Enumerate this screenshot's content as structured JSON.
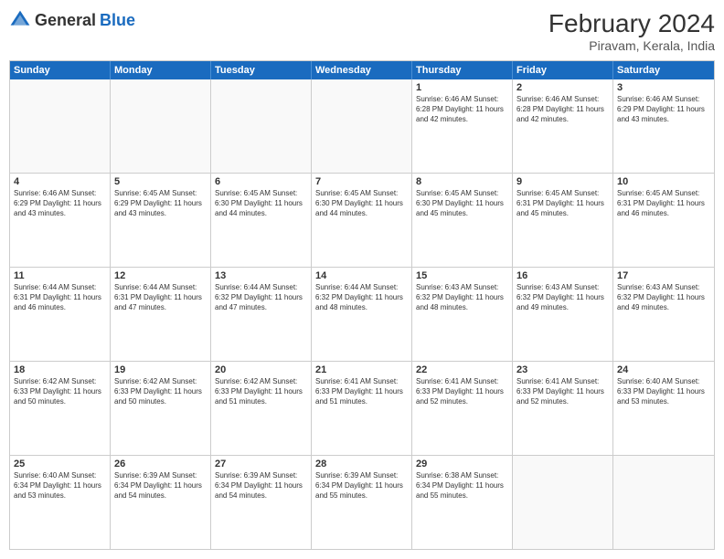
{
  "header": {
    "logo_general": "General",
    "logo_blue": "Blue",
    "month_year": "February 2024",
    "location": "Piravam, Kerala, India"
  },
  "days_of_week": [
    "Sunday",
    "Monday",
    "Tuesday",
    "Wednesday",
    "Thursday",
    "Friday",
    "Saturday"
  ],
  "weeks": [
    [
      {
        "day": "",
        "info": "",
        "empty": true
      },
      {
        "day": "",
        "info": "",
        "empty": true
      },
      {
        "day": "",
        "info": "",
        "empty": true
      },
      {
        "day": "",
        "info": "",
        "empty": true
      },
      {
        "day": "1",
        "info": "Sunrise: 6:46 AM\nSunset: 6:28 PM\nDaylight: 11 hours and 42 minutes.",
        "empty": false
      },
      {
        "day": "2",
        "info": "Sunrise: 6:46 AM\nSunset: 6:28 PM\nDaylight: 11 hours and 42 minutes.",
        "empty": false
      },
      {
        "day": "3",
        "info": "Sunrise: 6:46 AM\nSunset: 6:29 PM\nDaylight: 11 hours and 43 minutes.",
        "empty": false
      }
    ],
    [
      {
        "day": "4",
        "info": "Sunrise: 6:46 AM\nSunset: 6:29 PM\nDaylight: 11 hours and 43 minutes.",
        "empty": false
      },
      {
        "day": "5",
        "info": "Sunrise: 6:45 AM\nSunset: 6:29 PM\nDaylight: 11 hours and 43 minutes.",
        "empty": false
      },
      {
        "day": "6",
        "info": "Sunrise: 6:45 AM\nSunset: 6:30 PM\nDaylight: 11 hours and 44 minutes.",
        "empty": false
      },
      {
        "day": "7",
        "info": "Sunrise: 6:45 AM\nSunset: 6:30 PM\nDaylight: 11 hours and 44 minutes.",
        "empty": false
      },
      {
        "day": "8",
        "info": "Sunrise: 6:45 AM\nSunset: 6:30 PM\nDaylight: 11 hours and 45 minutes.",
        "empty": false
      },
      {
        "day": "9",
        "info": "Sunrise: 6:45 AM\nSunset: 6:31 PM\nDaylight: 11 hours and 45 minutes.",
        "empty": false
      },
      {
        "day": "10",
        "info": "Sunrise: 6:45 AM\nSunset: 6:31 PM\nDaylight: 11 hours and 46 minutes.",
        "empty": false
      }
    ],
    [
      {
        "day": "11",
        "info": "Sunrise: 6:44 AM\nSunset: 6:31 PM\nDaylight: 11 hours and 46 minutes.",
        "empty": false
      },
      {
        "day": "12",
        "info": "Sunrise: 6:44 AM\nSunset: 6:31 PM\nDaylight: 11 hours and 47 minutes.",
        "empty": false
      },
      {
        "day": "13",
        "info": "Sunrise: 6:44 AM\nSunset: 6:32 PM\nDaylight: 11 hours and 47 minutes.",
        "empty": false
      },
      {
        "day": "14",
        "info": "Sunrise: 6:44 AM\nSunset: 6:32 PM\nDaylight: 11 hours and 48 minutes.",
        "empty": false
      },
      {
        "day": "15",
        "info": "Sunrise: 6:43 AM\nSunset: 6:32 PM\nDaylight: 11 hours and 48 minutes.",
        "empty": false
      },
      {
        "day": "16",
        "info": "Sunrise: 6:43 AM\nSunset: 6:32 PM\nDaylight: 11 hours and 49 minutes.",
        "empty": false
      },
      {
        "day": "17",
        "info": "Sunrise: 6:43 AM\nSunset: 6:32 PM\nDaylight: 11 hours and 49 minutes.",
        "empty": false
      }
    ],
    [
      {
        "day": "18",
        "info": "Sunrise: 6:42 AM\nSunset: 6:33 PM\nDaylight: 11 hours and 50 minutes.",
        "empty": false
      },
      {
        "day": "19",
        "info": "Sunrise: 6:42 AM\nSunset: 6:33 PM\nDaylight: 11 hours and 50 minutes.",
        "empty": false
      },
      {
        "day": "20",
        "info": "Sunrise: 6:42 AM\nSunset: 6:33 PM\nDaylight: 11 hours and 51 minutes.",
        "empty": false
      },
      {
        "day": "21",
        "info": "Sunrise: 6:41 AM\nSunset: 6:33 PM\nDaylight: 11 hours and 51 minutes.",
        "empty": false
      },
      {
        "day": "22",
        "info": "Sunrise: 6:41 AM\nSunset: 6:33 PM\nDaylight: 11 hours and 52 minutes.",
        "empty": false
      },
      {
        "day": "23",
        "info": "Sunrise: 6:41 AM\nSunset: 6:33 PM\nDaylight: 11 hours and 52 minutes.",
        "empty": false
      },
      {
        "day": "24",
        "info": "Sunrise: 6:40 AM\nSunset: 6:33 PM\nDaylight: 11 hours and 53 minutes.",
        "empty": false
      }
    ],
    [
      {
        "day": "25",
        "info": "Sunrise: 6:40 AM\nSunset: 6:34 PM\nDaylight: 11 hours and 53 minutes.",
        "empty": false
      },
      {
        "day": "26",
        "info": "Sunrise: 6:39 AM\nSunset: 6:34 PM\nDaylight: 11 hours and 54 minutes.",
        "empty": false
      },
      {
        "day": "27",
        "info": "Sunrise: 6:39 AM\nSunset: 6:34 PM\nDaylight: 11 hours and 54 minutes.",
        "empty": false
      },
      {
        "day": "28",
        "info": "Sunrise: 6:39 AM\nSunset: 6:34 PM\nDaylight: 11 hours and 55 minutes.",
        "empty": false
      },
      {
        "day": "29",
        "info": "Sunrise: 6:38 AM\nSunset: 6:34 PM\nDaylight: 11 hours and 55 minutes.",
        "empty": false
      },
      {
        "day": "",
        "info": "",
        "empty": true
      },
      {
        "day": "",
        "info": "",
        "empty": true
      }
    ]
  ]
}
